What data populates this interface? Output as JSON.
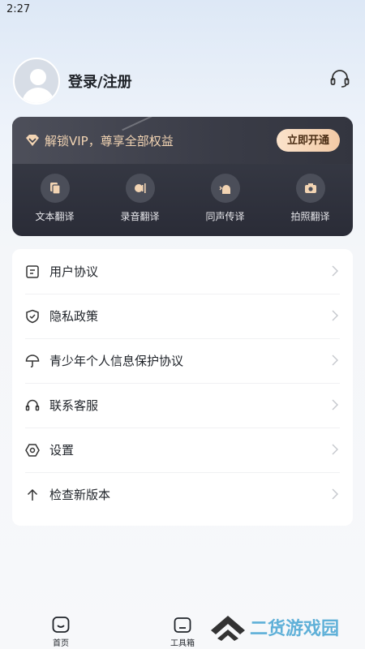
{
  "status_bar": {
    "time": "2:27"
  },
  "profile": {
    "login_label": "登录/注册"
  },
  "vip": {
    "banner_text": "解锁VIP，尊享全部权益",
    "open_button": "立即开通",
    "tools": [
      {
        "label": "文本翻译",
        "icon": "document-copy-icon"
      },
      {
        "label": "录音翻译",
        "icon": "voice-record-icon"
      },
      {
        "label": "同声传译",
        "icon": "speaker-person-icon"
      },
      {
        "label": "拍照翻译",
        "icon": "camera-icon"
      }
    ]
  },
  "menu": {
    "items": [
      {
        "label": "用户协议",
        "icon": "document-icon"
      },
      {
        "label": "隐私政策",
        "icon": "shield-check-icon"
      },
      {
        "label": "青少年个人信息保护协议",
        "icon": "umbrella-icon"
      },
      {
        "label": "联系客服",
        "icon": "headset-icon"
      },
      {
        "label": "设置",
        "icon": "gear-icon"
      },
      {
        "label": "检查新版本",
        "icon": "arrow-up-icon"
      }
    ]
  },
  "tabs": [
    {
      "label": "首页",
      "icon": "home-icon"
    },
    {
      "label": "工具箱",
      "icon": "toolbox-icon"
    }
  ],
  "watermark": {
    "text": "二货游戏园"
  },
  "colors": {
    "vip_gold": "#f2d4b3",
    "vip_card": "#2a2c37",
    "watermark": "#5fb0d8"
  }
}
